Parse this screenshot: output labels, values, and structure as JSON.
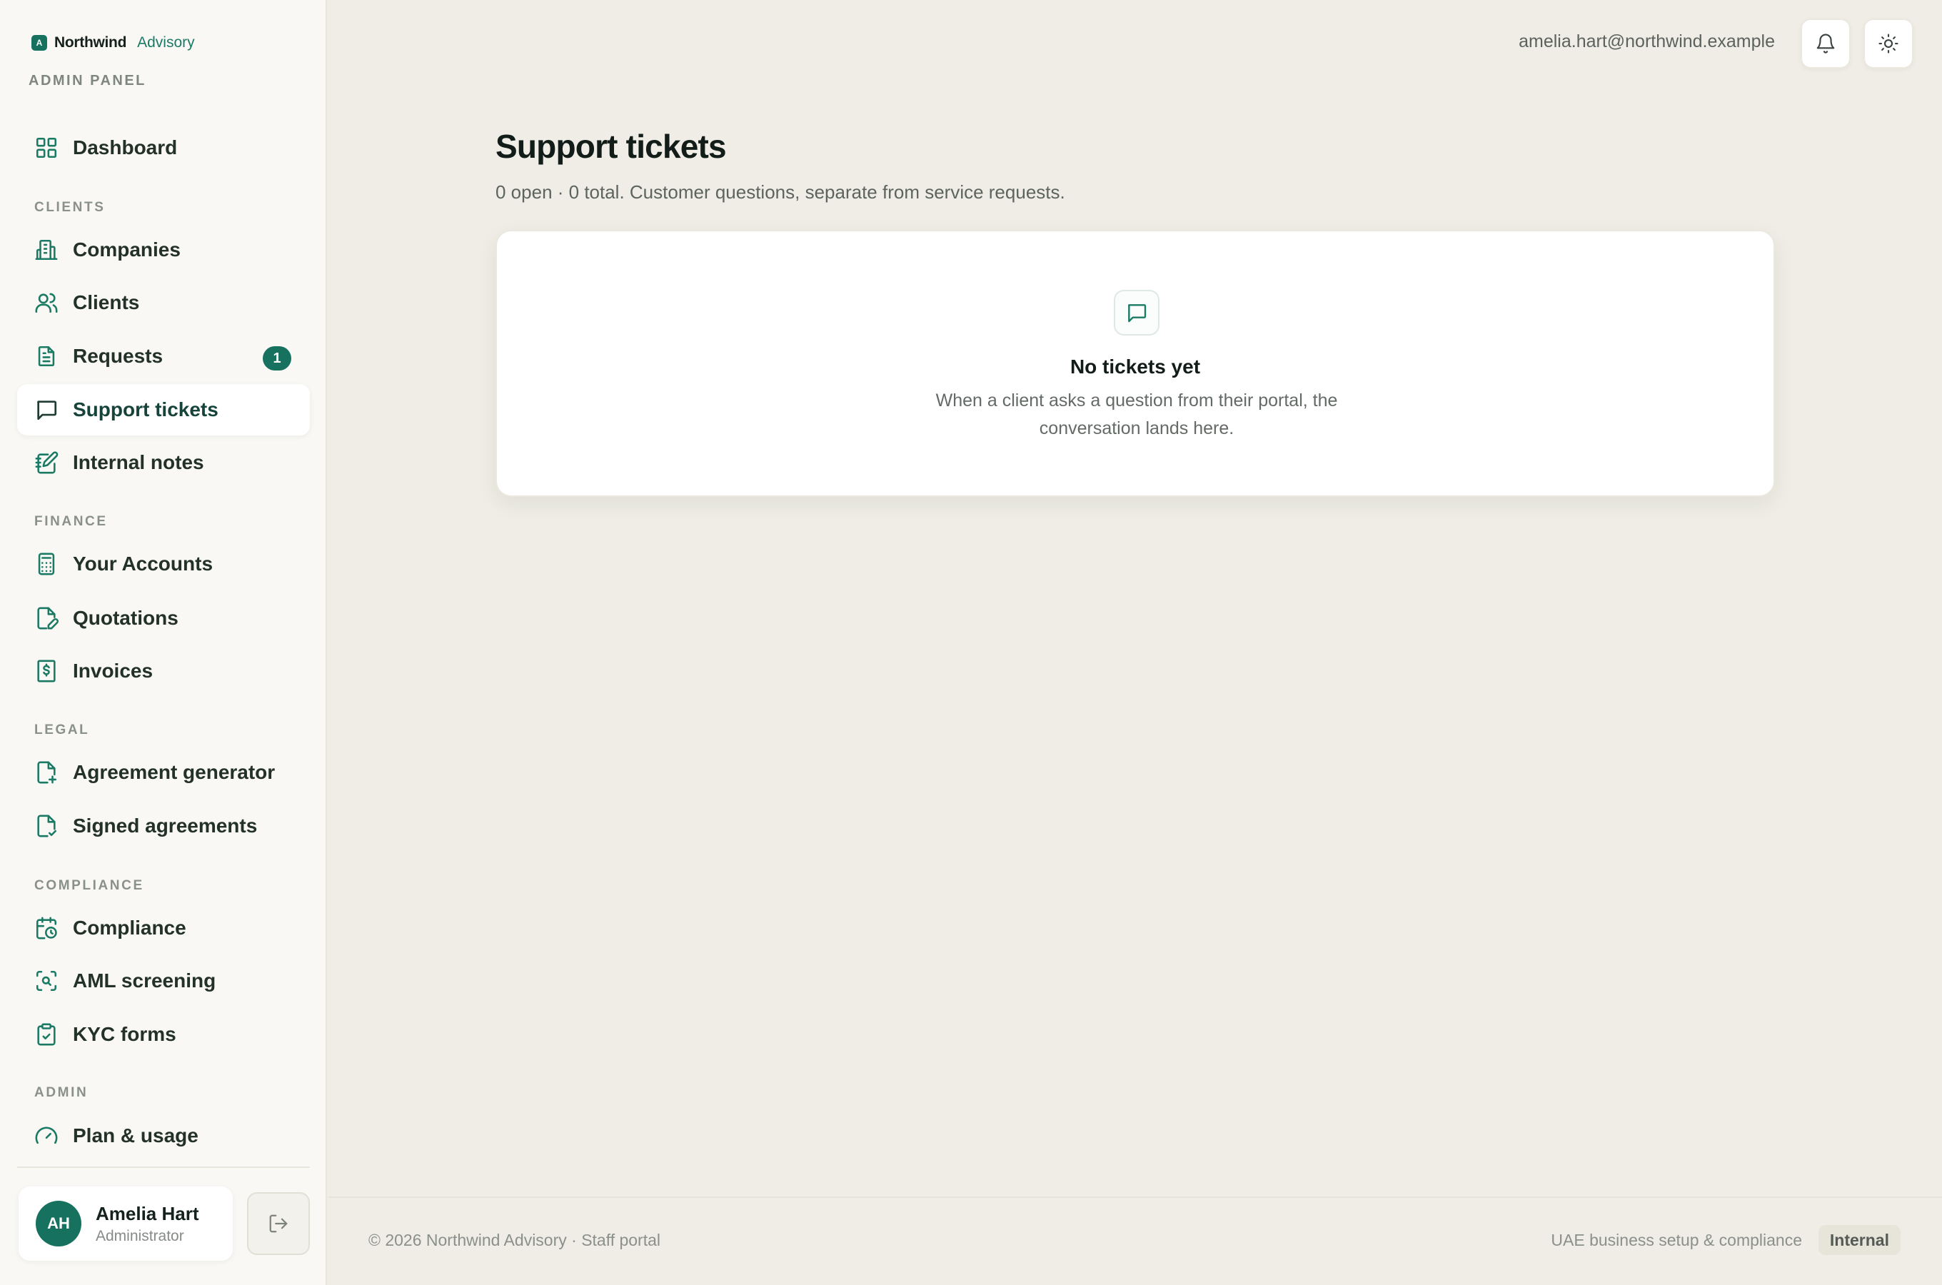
{
  "brand": {
    "logo_letter": "A",
    "name": "Northwind",
    "sub": "Advisory",
    "panel_label": "ADMIN PANEL"
  },
  "sidebar": {
    "sections": [
      "CLIENTS",
      "FINANCE",
      "LEGAL",
      "COMPLIANCE",
      "ADMIN"
    ],
    "items": [
      {
        "label": "Dashboard",
        "icon": "grid-icon"
      },
      {
        "label": "Companies",
        "icon": "building-icon"
      },
      {
        "label": "Clients",
        "icon": "users-icon"
      },
      {
        "label": "Requests",
        "icon": "document-icon",
        "badge": "1"
      },
      {
        "label": "Support tickets",
        "icon": "message-square-icon",
        "active": true
      },
      {
        "label": "Internal notes",
        "icon": "notebook-pen-icon"
      },
      {
        "label": "Your Accounts",
        "icon": "calculator-icon"
      },
      {
        "label": "Quotations",
        "icon": "file-pen-icon"
      },
      {
        "label": "Invoices",
        "icon": "receipt-dollar-icon"
      },
      {
        "label": "Agreement generator",
        "icon": "file-plus-icon"
      },
      {
        "label": "Signed agreements",
        "icon": "file-check-icon"
      },
      {
        "label": "Compliance",
        "icon": "calendar-clock-icon"
      },
      {
        "label": "AML screening",
        "icon": "scan-search-icon"
      },
      {
        "label": "KYC forms",
        "icon": "clipboard-check-icon"
      },
      {
        "label": "Plan & usage",
        "icon": "gauge-icon"
      }
    ]
  },
  "user": {
    "initials": "AH",
    "name": "Amelia Hart",
    "role": "Administrator"
  },
  "topbar": {
    "email": "amelia.hart@northwind.example"
  },
  "main": {
    "title": "Support tickets",
    "subtitle": "0 open · 0 total. Customer questions, separate from service requests.",
    "empty": {
      "title": "No tickets yet",
      "text": "When a client asks a question from their portal, the conversation lands here."
    }
  },
  "footer": {
    "left": "© 2026 Northwind Advisory · Staff portal",
    "right": "UAE business setup & compliance",
    "pill": "Internal"
  },
  "colors": {
    "accent": "#16715f",
    "background": "#efede5",
    "sidebar": "#f9f8f5"
  }
}
